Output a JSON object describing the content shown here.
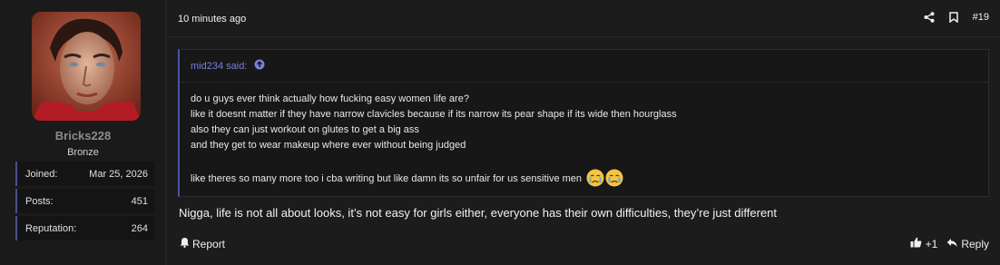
{
  "user": {
    "username": "Bricks228",
    "title": "Bronze",
    "stats": [
      {
        "label": "Joined:",
        "value": "Mar 25, 2026"
      },
      {
        "label": "Posts:",
        "value": "451"
      },
      {
        "label": "Reputation:",
        "value": "264"
      }
    ]
  },
  "post": {
    "date": "10 minutes ago",
    "number": "#19",
    "quote": {
      "author": "mid234 said:",
      "lines": [
        "do u guys ever think actually how fucking easy women life are?",
        "like it doesnt matter if they have narrow clavicles because if its narrow its pear shape if its wide then hourglass",
        "also they can just workout on glutes to get a big ass",
        "and they get to wear makeup where ever without being judged"
      ],
      "last_line": "like theres so many more too i cba writing but like damn its so unfair for us sensitive men"
    },
    "text": "Nigga, life is not all about looks, it’s not easy for girls either, everyone has their own difficulties, they’re just different",
    "report_label": "Report",
    "like_count": "+1",
    "reply_label": "Reply"
  },
  "icons": {
    "share": "share-icon",
    "bookmark": "bookmark-icon",
    "up_arrow": "arrow-up-circle-icon",
    "emoji": "crying-face-emoji",
    "report": "bell-icon",
    "like": "thumbs-up-icon",
    "reply": "reply-arrow-icon"
  },
  "colors": {
    "accent": "#7c7fe0",
    "stat_border": "#4c4f8f",
    "background": "#1c1c1c"
  }
}
